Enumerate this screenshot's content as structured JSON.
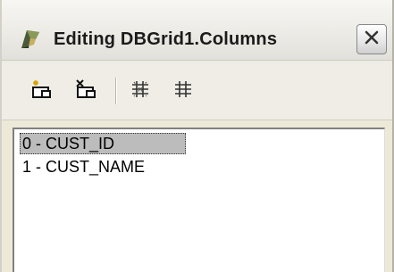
{
  "window": {
    "title": "Editing DBGrid1.Columns"
  },
  "titlebar": {
    "app_icon": "delphi-helmet-icon",
    "close_icon": "close-icon"
  },
  "toolbar": {
    "buttons": [
      {
        "icon": "add-new-icon"
      },
      {
        "icon": "delete-selected-icon"
      },
      {
        "icon": "add-all-fields-icon"
      },
      {
        "icon": "restore-defaults-icon"
      }
    ]
  },
  "columns": {
    "items": [
      {
        "label": "0 - CUST_ID",
        "selected": true
      },
      {
        "label": "1 - CUST_NAME",
        "selected": false
      }
    ]
  },
  "colors": {
    "selection_bg": "#bcbcbc",
    "window_bg": "#ece9d8"
  }
}
